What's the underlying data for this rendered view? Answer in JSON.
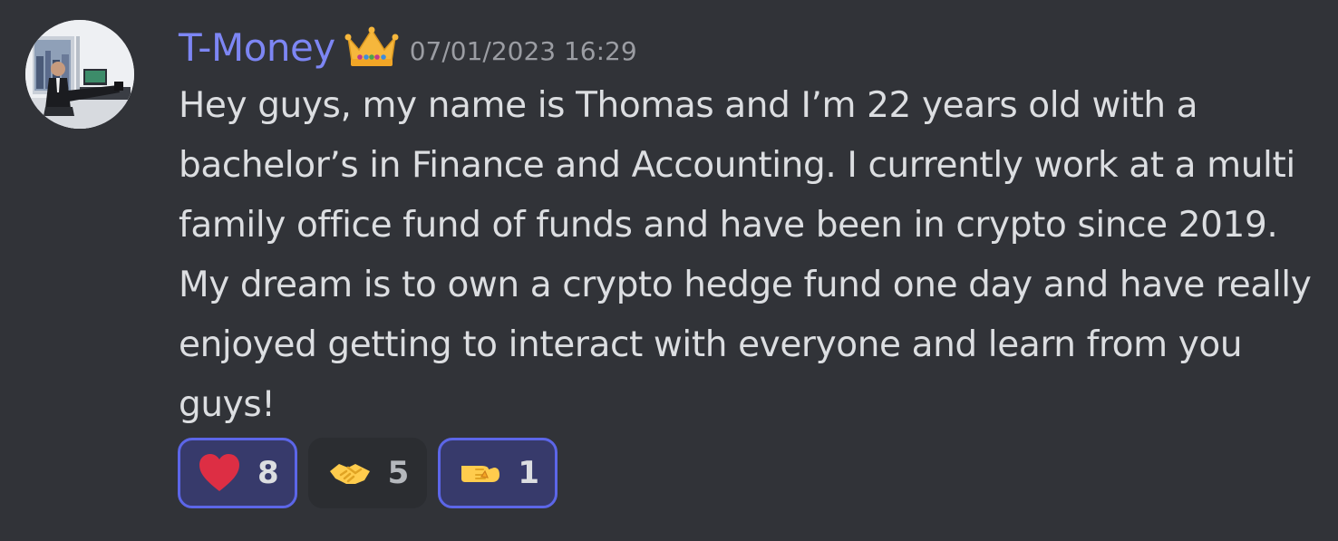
{
  "message": {
    "author": "T-Money",
    "author_color": "#7d86f4",
    "badge_icon": "crown-icon",
    "timestamp": "07/01/2023 16:29",
    "content": "Hey guys, my name is Thomas and I’m 22 years old with a bachelor’s in Finance and Accounting. I currently work at a multi family office fund of funds and have been in crypto since 2019. My dream is to own a crypto hedge fund one day and have really enjoyed getting to interact with everyone and learn from you guys!"
  },
  "reactions": [
    {
      "emoji": "heart-icon",
      "count": "8",
      "active": true
    },
    {
      "emoji": "handshake-icon",
      "count": "5",
      "active": false
    },
    {
      "emoji": "fist-bump-icon",
      "count": "1",
      "active": true
    }
  ],
  "colors": {
    "background": "#313338",
    "text": "#dcdee1",
    "timestamp": "#9b9da3",
    "reaction_active_border": "#5c66e8",
    "reaction_active_bg": "#373a6b",
    "reaction_bg": "#2b2d31"
  }
}
